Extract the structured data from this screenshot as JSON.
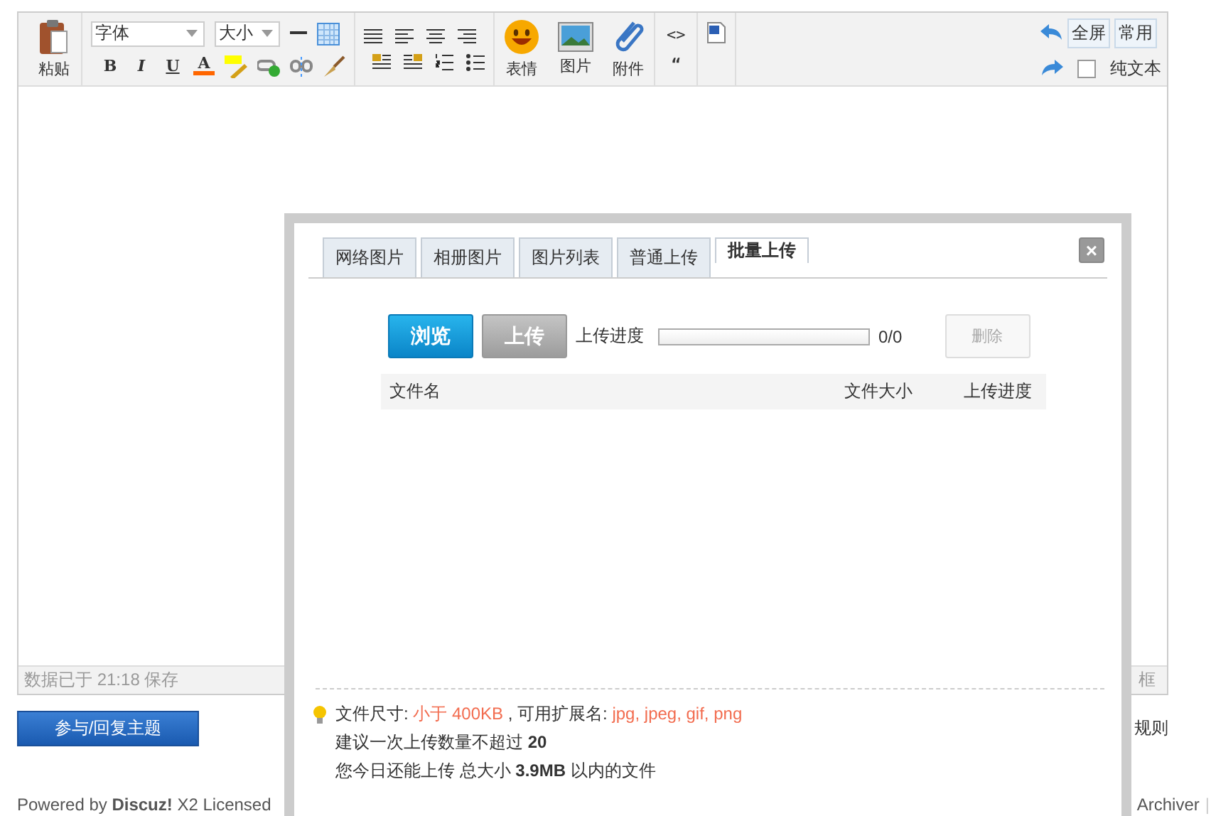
{
  "toolbar": {
    "paste_label": "粘贴",
    "font_select": "字体",
    "size_select": "大小",
    "format_buttons": [
      {
        "glyph": "B",
        "kind": "bold"
      },
      {
        "glyph": "I",
        "kind": "italic"
      },
      {
        "glyph": "U",
        "kind": "underline"
      },
      {
        "glyph": "A",
        "kind": "color"
      }
    ],
    "media": [
      {
        "label": "表情",
        "kind": "smiley"
      },
      {
        "label": "图片",
        "kind": "image"
      },
      {
        "label": "附件",
        "kind": "attachment"
      }
    ],
    "code_glyph": "<>",
    "quote_glyph": "“",
    "fullscreen_button": "全屏",
    "common_button": "常用",
    "plain_text": {
      "label": "纯文本",
      "checked": false
    }
  },
  "status_bar": {
    "save_text": "数据已于  21:18 保存",
    "right_text": "框"
  },
  "reply_button": "参与/回复主题",
  "rules_text": "规则",
  "footer": {
    "powered": "Powered by **Discuz!** X2 Licensed",
    "archiver": "Archiver",
    "separator": "|"
  },
  "dialog": {
    "tabs": [
      {
        "label": "网络图片",
        "selected": false
      },
      {
        "label": "相册图片",
        "selected": false
      },
      {
        "label": "图片列表",
        "selected": false
      },
      {
        "label": "普通上传",
        "selected": false
      },
      {
        "label": "批量上传",
        "selected": true
      }
    ],
    "close_glyph": "×",
    "browse_button": "浏览",
    "upload_button": {
      "label": "上传",
      "disabled": true
    },
    "progress_label": "上传进度",
    "progress": {
      "level": 0
    },
    "progress_count": "0/0",
    "delete_button": {
      "label": "删除",
      "disabled": true
    },
    "columns": [
      "文件名",
      "文件大小",
      "上传进度"
    ],
    "notes": [
      {
        "kind": "segments",
        "segments": [
          {
            "text": "文件尺寸: ",
            "kind": "normal"
          },
          {
            "text": "小于  400KB",
            "kind": "highlight"
          },
          {
            "text": " , 可用扩展名: ",
            "kind": "normal"
          },
          {
            "text": "jpg, jpeg, gif, png",
            "kind": "highlight"
          }
        ]
      },
      {
        "kind": "rich",
        "text": "建议一次上传数量不超过  **20**"
      },
      {
        "kind": "rich",
        "text": "您今日还能上传  总大小  **3.9MB** 以内的文件"
      }
    ]
  }
}
